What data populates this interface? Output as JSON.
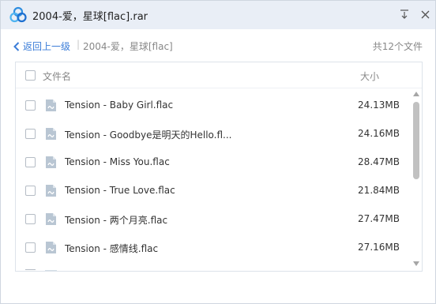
{
  "window": {
    "title": "2004-爱，星球[flac].rar"
  },
  "nav": {
    "back_label": "返回上一级",
    "separator": "|",
    "breadcrumb": "2004-爱，星球[flac]",
    "total_label": "共12个文件"
  },
  "list": {
    "header": {
      "name": "文件名",
      "size": "大小"
    },
    "rows": [
      {
        "name": "Tension - Baby Girl.flac",
        "size": "24.13MB"
      },
      {
        "name": "Tension - Goodbye是明天的Hello.fl...",
        "size": "24.16MB"
      },
      {
        "name": "Tension - Miss You.flac",
        "size": "28.47MB"
      },
      {
        "name": "Tension - True Love.flac",
        "size": "21.84MB"
      },
      {
        "name": "Tension - 两个月亮.flac",
        "size": "27.47MB"
      },
      {
        "name": "Tension - 感情线.flac",
        "size": "27.16MB"
      }
    ]
  },
  "icons": {
    "app": "cloud-logo-icon",
    "minimize": "minimize-icon",
    "close": "close-icon",
    "back": "chevron-left-icon",
    "file": "audio-file-icon"
  },
  "colors": {
    "accent": "#3b7dd8",
    "titlebar": "#e9eef6",
    "file_icon": "#b9c6d3"
  }
}
